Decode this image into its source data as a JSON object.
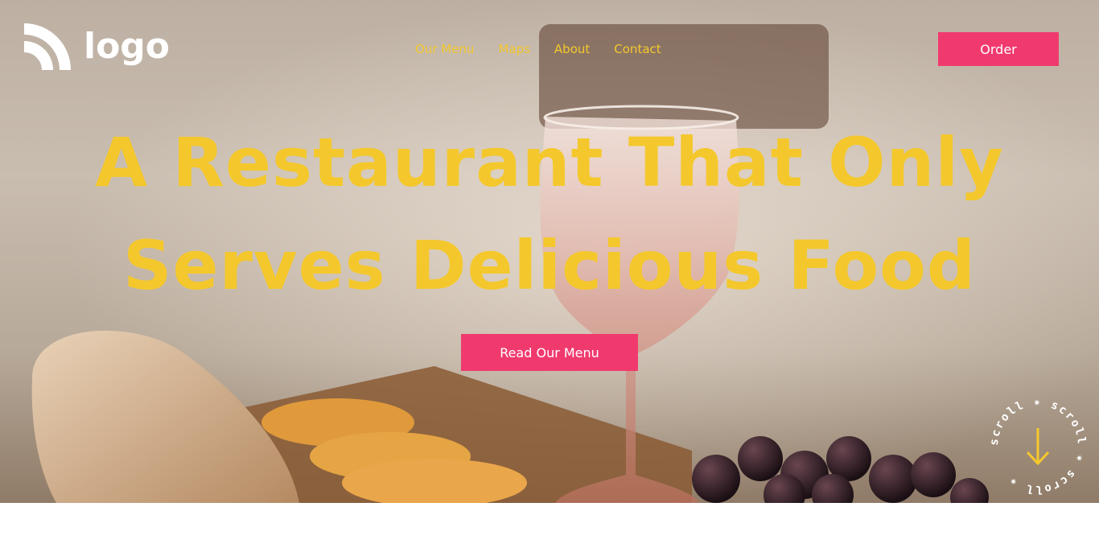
{
  "brand": {
    "logo_text": "logo"
  },
  "nav": {
    "items": [
      {
        "label": "Our Menu"
      },
      {
        "label": "Maps"
      },
      {
        "label": "About"
      },
      {
        "label": "Contact"
      }
    ]
  },
  "header": {
    "order_label": "Order"
  },
  "hero": {
    "headline_line1": "A Restaurant That Only",
    "headline_line2": "Serves Delicious Food",
    "cta_label": "Read Our Menu",
    "background": "photo of bread, orange slices on a wooden board, a glass of rosé wine and grapes on a lace tablecloth"
  },
  "scroll_badge": {
    "text": "scroll ✷ scroll ✷ scroll ✷",
    "icon": "arrow-down-icon"
  },
  "colors": {
    "accent_yellow": "#f4c82c",
    "accent_pink": "#f03a6e",
    "white": "#ffffff"
  }
}
